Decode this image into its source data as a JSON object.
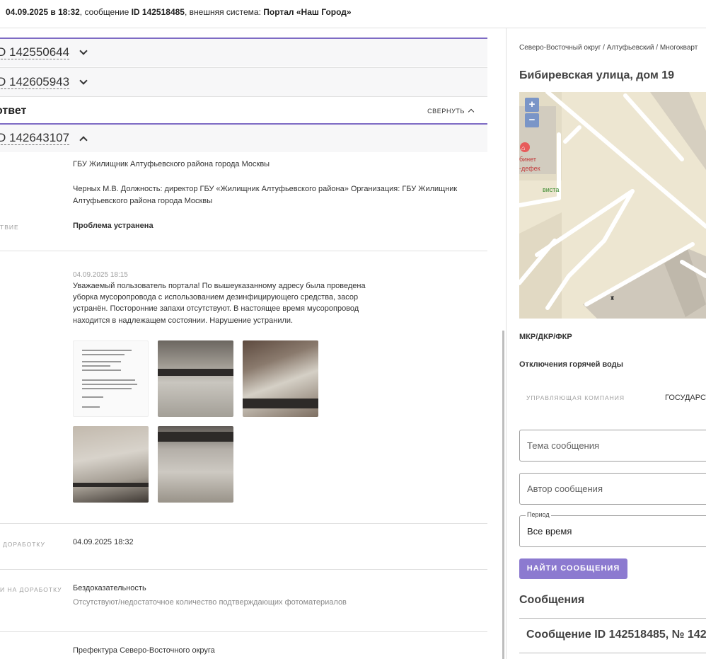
{
  "topbar": {
    "date": "04.09.2025 в 18:32",
    "msg_prefix": ", сообщение ",
    "msg_id": "ID 142518485",
    "sys_prefix": ", внешняя система: ",
    "system": "Портал «Наш Город»"
  },
  "accordions": [
    {
      "label": "D 142550644"
    },
    {
      "label": "D 142605943"
    },
    {
      "label": "D 142643107"
    }
  ],
  "answer": {
    "title": "ответ",
    "collapse_label": "СВЕРНУТЬ"
  },
  "details": {
    "org": "ГБУ Жилищник Алтуфьевского района города Москвы",
    "person_line1": "Черных М.В. Должность: директор ГБУ «Жилищник Алтуфьевского района» Организация: ГБУ Жилищник",
    "person_line2": "Алтуфьевского района города Москвы",
    "status_label": "ТВИЕ",
    "status_value": "Проблема устранена",
    "reply_date": "04.09.2025 18:15",
    "reply_lines": [
      "Уважаемый пользователь портала! По вышеуказанному адресу была проведена",
      "уборка мусоропровода с использованием дезинфицирующего средства, засор",
      "устранён. Посторонние запахи отсутствуют. В настоящее время мусоропровод",
      "находится в надлежащем состоянии. Нарушение устранили."
    ],
    "rework_label": "ДОРАБОТКУ",
    "rework_date": "04.09.2025 18:32",
    "reason_label": "И НА ДОРАБОТКУ",
    "reason_value": "Бездоказательность",
    "reason_note": "Отсутствуют/недостаточное количество подтверждающих фотоматериалов",
    "prefecture": "Префектура Северо-Восточного округа"
  },
  "right": {
    "breadcrumb": "Северо-Восточный округ / Алтуфьевский / Многокварт",
    "address": "Бибиревская улица, дом 19",
    "map": {
      "zoom_in": "+",
      "zoom_out": "−",
      "poi_line1": "бинет",
      "poi_line2": "-дефек",
      "poi_green": "виста",
      "parking": "P"
    },
    "section1": "МКР/ДКР/ФКР",
    "section2": "Отключения горячей воды",
    "mgmt_label": "УПРАВЛЯЮЩАЯ КОМПАНИЯ",
    "mgmt_value": "ГОСУДАРСТ",
    "topic_placeholder": "Тема сообщения",
    "author_placeholder": "Автор сообщения",
    "period_label": "Период",
    "period_value": "Все время",
    "search_button": "НАЙТИ СООБЩЕНИЯ",
    "messages_title": "Сообщения",
    "message_card": "Сообщение ID 142518485, № 142"
  },
  "colors": {
    "accent": "#8c7ad0",
    "accordion_border": "#7e6bc4"
  }
}
